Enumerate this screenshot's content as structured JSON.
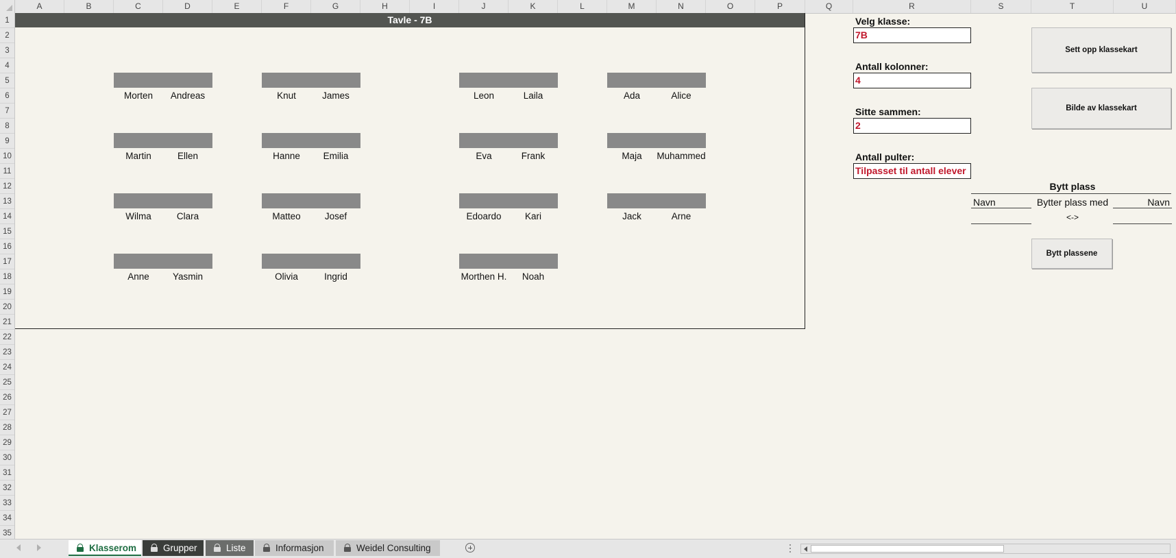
{
  "columns": [
    "A",
    "B",
    "C",
    "D",
    "E",
    "F",
    "G",
    "H",
    "I",
    "J",
    "K",
    "L",
    "M",
    "N",
    "O",
    "P",
    "Q",
    "R",
    "S",
    "T",
    "U"
  ],
  "rows": [
    "1",
    "2",
    "3",
    "4",
    "5",
    "6",
    "7",
    "8",
    "9",
    "10",
    "11",
    "12",
    "13",
    "14",
    "15",
    "16",
    "17",
    "18",
    "19",
    "20",
    "21",
    "22",
    "23",
    "24",
    "25",
    "26",
    "27",
    "28",
    "29",
    "30",
    "31",
    "32",
    "33",
    "34",
    "35"
  ],
  "board": {
    "title": "Tavle - 7B",
    "desks": [
      [
        "Morten",
        "Andreas"
      ],
      [
        "Knut",
        "James"
      ],
      [
        "Leon",
        "Laila"
      ],
      [
        "Ada",
        "Alice"
      ],
      [
        "Martin",
        "Ellen"
      ],
      [
        "Hanne",
        "Emilia"
      ],
      [
        "Eva",
        "Frank"
      ],
      [
        "Maja",
        "Muhammed"
      ],
      [
        "Wilma",
        "Clara"
      ],
      [
        "Matteo",
        "Josef"
      ],
      [
        "Edoardo",
        "Kari"
      ],
      [
        "Jack",
        "Arne"
      ],
      [
        "Anne",
        "Yasmin"
      ],
      [
        "Olivia",
        "Ingrid"
      ],
      [
        "Morthen H.",
        "Noah"
      ]
    ]
  },
  "panel": {
    "velg_klasse_label": "Velg klasse:",
    "velg_klasse_value": "7B",
    "antall_kolonner_label": "Antall kolonner:",
    "antall_kolonner_value": "4",
    "sitte_sammen_label": "Sitte sammen:",
    "sitte_sammen_value": "2",
    "antall_pulter_label": "Antall pulter:",
    "antall_pulter_value": "Tilpasset til antall elever",
    "accent_color": "#c0172b"
  },
  "buttons": {
    "sett_opp": "Sett opp klassekart",
    "bilde": "Bilde av klassekart",
    "bytt_plassene": "Bytt plassene"
  },
  "swap": {
    "title": "Bytt plass",
    "navn_left": "Navn",
    "bytter_med": "Bytter plass med",
    "navn_right": "Navn",
    "arrow": "<->"
  },
  "sheet_tabs": [
    {
      "label": "Klasserom",
      "active": true
    },
    {
      "label": "Grupper",
      "active": false
    },
    {
      "label": "Liste",
      "active": false
    },
    {
      "label": "Informasjon",
      "active": false
    },
    {
      "label": "Weidel Consulting",
      "active": false
    }
  ]
}
